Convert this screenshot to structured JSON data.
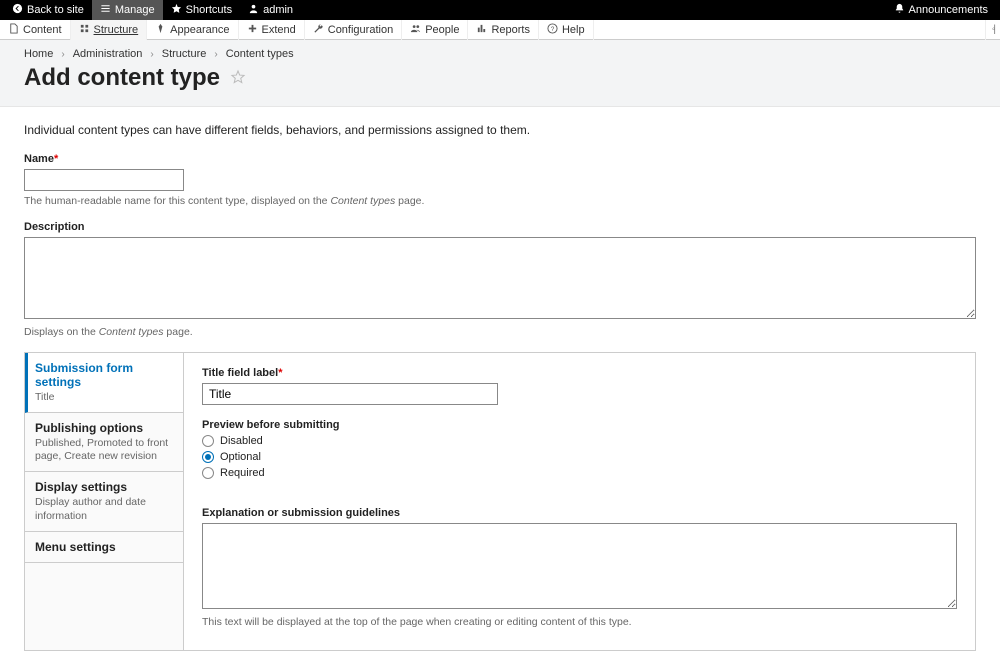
{
  "topbar": {
    "back": "Back to site",
    "manage": "Manage",
    "shortcuts": "Shortcuts",
    "user": "admin",
    "announcements": "Announcements"
  },
  "adminbar": {
    "content": "Content",
    "structure": "Structure",
    "appearance": "Appearance",
    "extend": "Extend",
    "configuration": "Configuration",
    "people": "People",
    "reports": "Reports",
    "help": "Help"
  },
  "breadcrumbs": {
    "home": "Home",
    "admin": "Administration",
    "structure": "Structure",
    "content_types": "Content types"
  },
  "page_title": "Add content type",
  "intro": "Individual content types can have different fields, behaviors, and permissions assigned to them.",
  "form": {
    "name_label": "Name",
    "name_hint_pre": "The human-readable name for this content type, displayed on the ",
    "name_hint_em": "Content types",
    "name_hint_post": " page.",
    "desc_label": "Description",
    "desc_hint_pre": "Displays on the ",
    "desc_hint_em": "Content types",
    "desc_hint_post": " page."
  },
  "vtabs": {
    "submission": {
      "title": "Submission form settings",
      "sub": "Title"
    },
    "publishing": {
      "title": "Publishing options",
      "sub": "Published, Promoted to front page, Create new revision"
    },
    "display": {
      "title": "Display settings",
      "sub": "Display author and date information"
    },
    "menu": {
      "title": "Menu settings"
    }
  },
  "tabcontent": {
    "title_field_label": "Title field label",
    "title_field_value": "Title",
    "preview_label": "Preview before submitting",
    "opt_disabled": "Disabled",
    "opt_optional": "Optional",
    "opt_required": "Required",
    "guidelines_label": "Explanation or submission guidelines",
    "guidelines_hint": "This text will be displayed at the top of the page when creating or editing content of this type."
  }
}
